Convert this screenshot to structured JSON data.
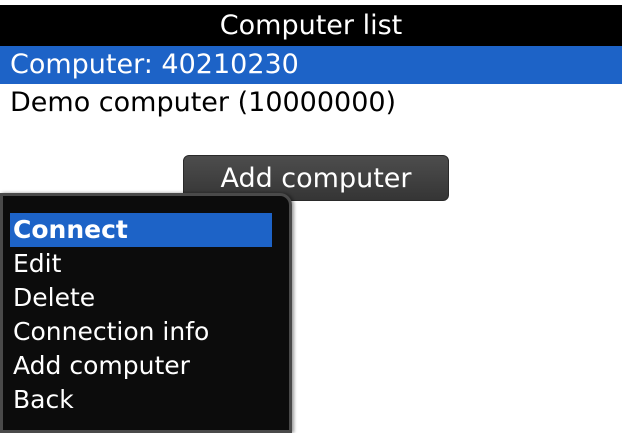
{
  "title": "Computer list",
  "computers": [
    {
      "label": "Computer: 40210230",
      "selected": true
    },
    {
      "label": "Demo computer (10000000)",
      "selected": false
    }
  ],
  "add_button_label": "Add computer",
  "menu": {
    "items": [
      {
        "label": "Connect",
        "selected": true
      },
      {
        "label": "Edit",
        "selected": false
      },
      {
        "label": "Delete",
        "selected": false
      },
      {
        "label": "Connection info",
        "selected": false
      },
      {
        "label": "Add computer",
        "selected": false
      },
      {
        "label": "Back",
        "selected": false
      }
    ]
  },
  "colors": {
    "selection": "#1d63c7",
    "title_bar": "#000000",
    "menu_background": "#0c0c0c"
  }
}
